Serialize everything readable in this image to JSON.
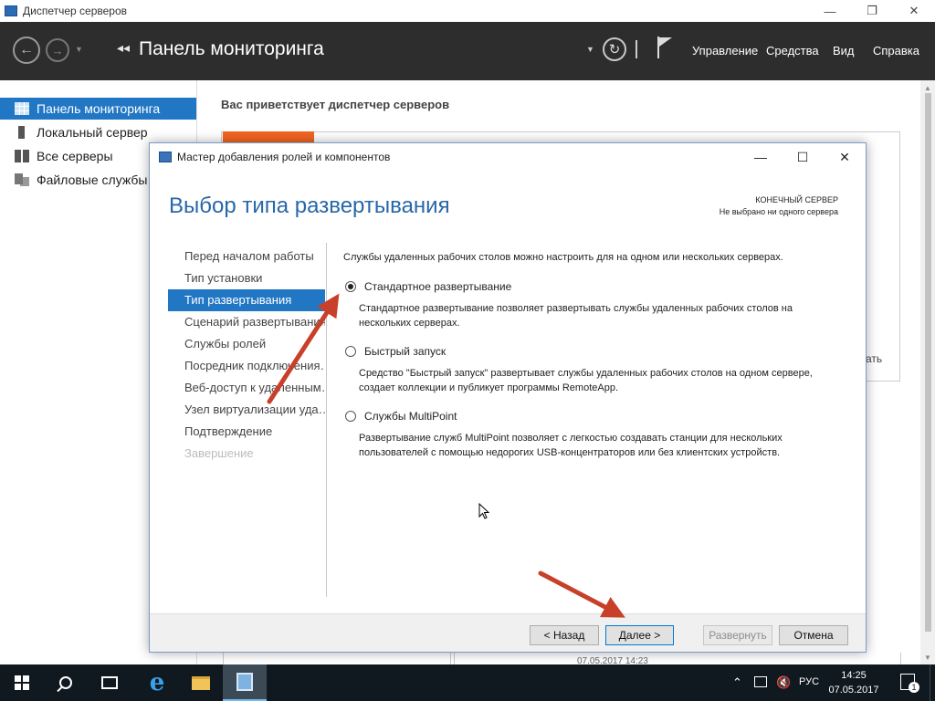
{
  "server_manager": {
    "title": "Диспетчер серверов",
    "window_controls": [
      "—",
      "❐",
      "✕"
    ],
    "header": {
      "chevron": "◂◂",
      "title": "Панель мониторинга",
      "menu": [
        "Управление",
        "Средства",
        "Вид",
        "Справка"
      ]
    },
    "sidebar": {
      "items": [
        {
          "label": "Панель мониторинга",
          "icon": "dashboard-icon",
          "active": true
        },
        {
          "label": "Локальный сервер",
          "icon": "server-icon"
        },
        {
          "label": "Все серверы",
          "icon": "servers-icon"
        },
        {
          "label": "Файловые службы",
          "icon": "file-services-icon"
        }
      ]
    },
    "main": {
      "welcome": "Вас приветствует диспетчер серверов",
      "partial_text": "ать",
      "partial_timestamp": "07.05.2017 14:23"
    }
  },
  "wizard": {
    "title": "Мастер добавления ролей и компонентов",
    "window_controls": [
      "—",
      "☐",
      "✕"
    ],
    "heading": "Выбор типа развертывания",
    "destination": {
      "label": "КОНЕЧНЫЙ СЕРВЕР",
      "value": "Не выбрано ни одного сервера"
    },
    "steps": [
      {
        "label": "Перед началом работы",
        "state": "normal"
      },
      {
        "label": "Тип установки",
        "state": "normal"
      },
      {
        "label": "Тип развертывания",
        "state": "active"
      },
      {
        "label": "Сценарий развертывания",
        "state": "normal"
      },
      {
        "label": "Службы ролей",
        "state": "normal"
      },
      {
        "label": "Посредник подключения…",
        "state": "normal"
      },
      {
        "label": "Веб-доступ к удаленным…",
        "state": "normal"
      },
      {
        "label": "Узел виртуализации уда…",
        "state": "normal"
      },
      {
        "label": "Подтверждение",
        "state": "normal"
      },
      {
        "label": "Завершение",
        "state": "disabled"
      }
    ],
    "intro": "Службы удаленных рабочих столов можно настроить для на одном или нескольких серверах.",
    "options": {
      "standard": {
        "label": "Стандартное развертывание",
        "checked": true,
        "description": "Стандартное развертывание позволяет развертывать службы удаленных рабочих столов на нескольких серверах."
      },
      "quick": {
        "label": "Быстрый запуск",
        "checked": false,
        "description": "Средство \"Быстрый запуск\" развертывает службы удаленных рабочих столов на одном сервере, создает коллекции и публикует программы RemoteApp."
      },
      "multipoint": {
        "label": "Службы MultiPoint",
        "checked": false,
        "description": "Развертывание служб MultiPoint позволяет с легкостью создавать станции для нескольких пользователей с помощью недорогих USB-концентраторов или без клиентских устройств."
      }
    },
    "buttons": {
      "back": "< Назад",
      "next": "Далее >",
      "deploy": "Развернуть",
      "cancel": "Отмена"
    }
  },
  "taskbar": {
    "language": "РУС",
    "time": "14:25",
    "date": "07.05.2017",
    "notification_count": "1"
  },
  "colors": {
    "accent": "#2277c4",
    "header_bg": "#2d2d2d",
    "heading": "#2867a8",
    "annotation_arrow": "#c8402a",
    "taskbar_bg": "#101820"
  }
}
